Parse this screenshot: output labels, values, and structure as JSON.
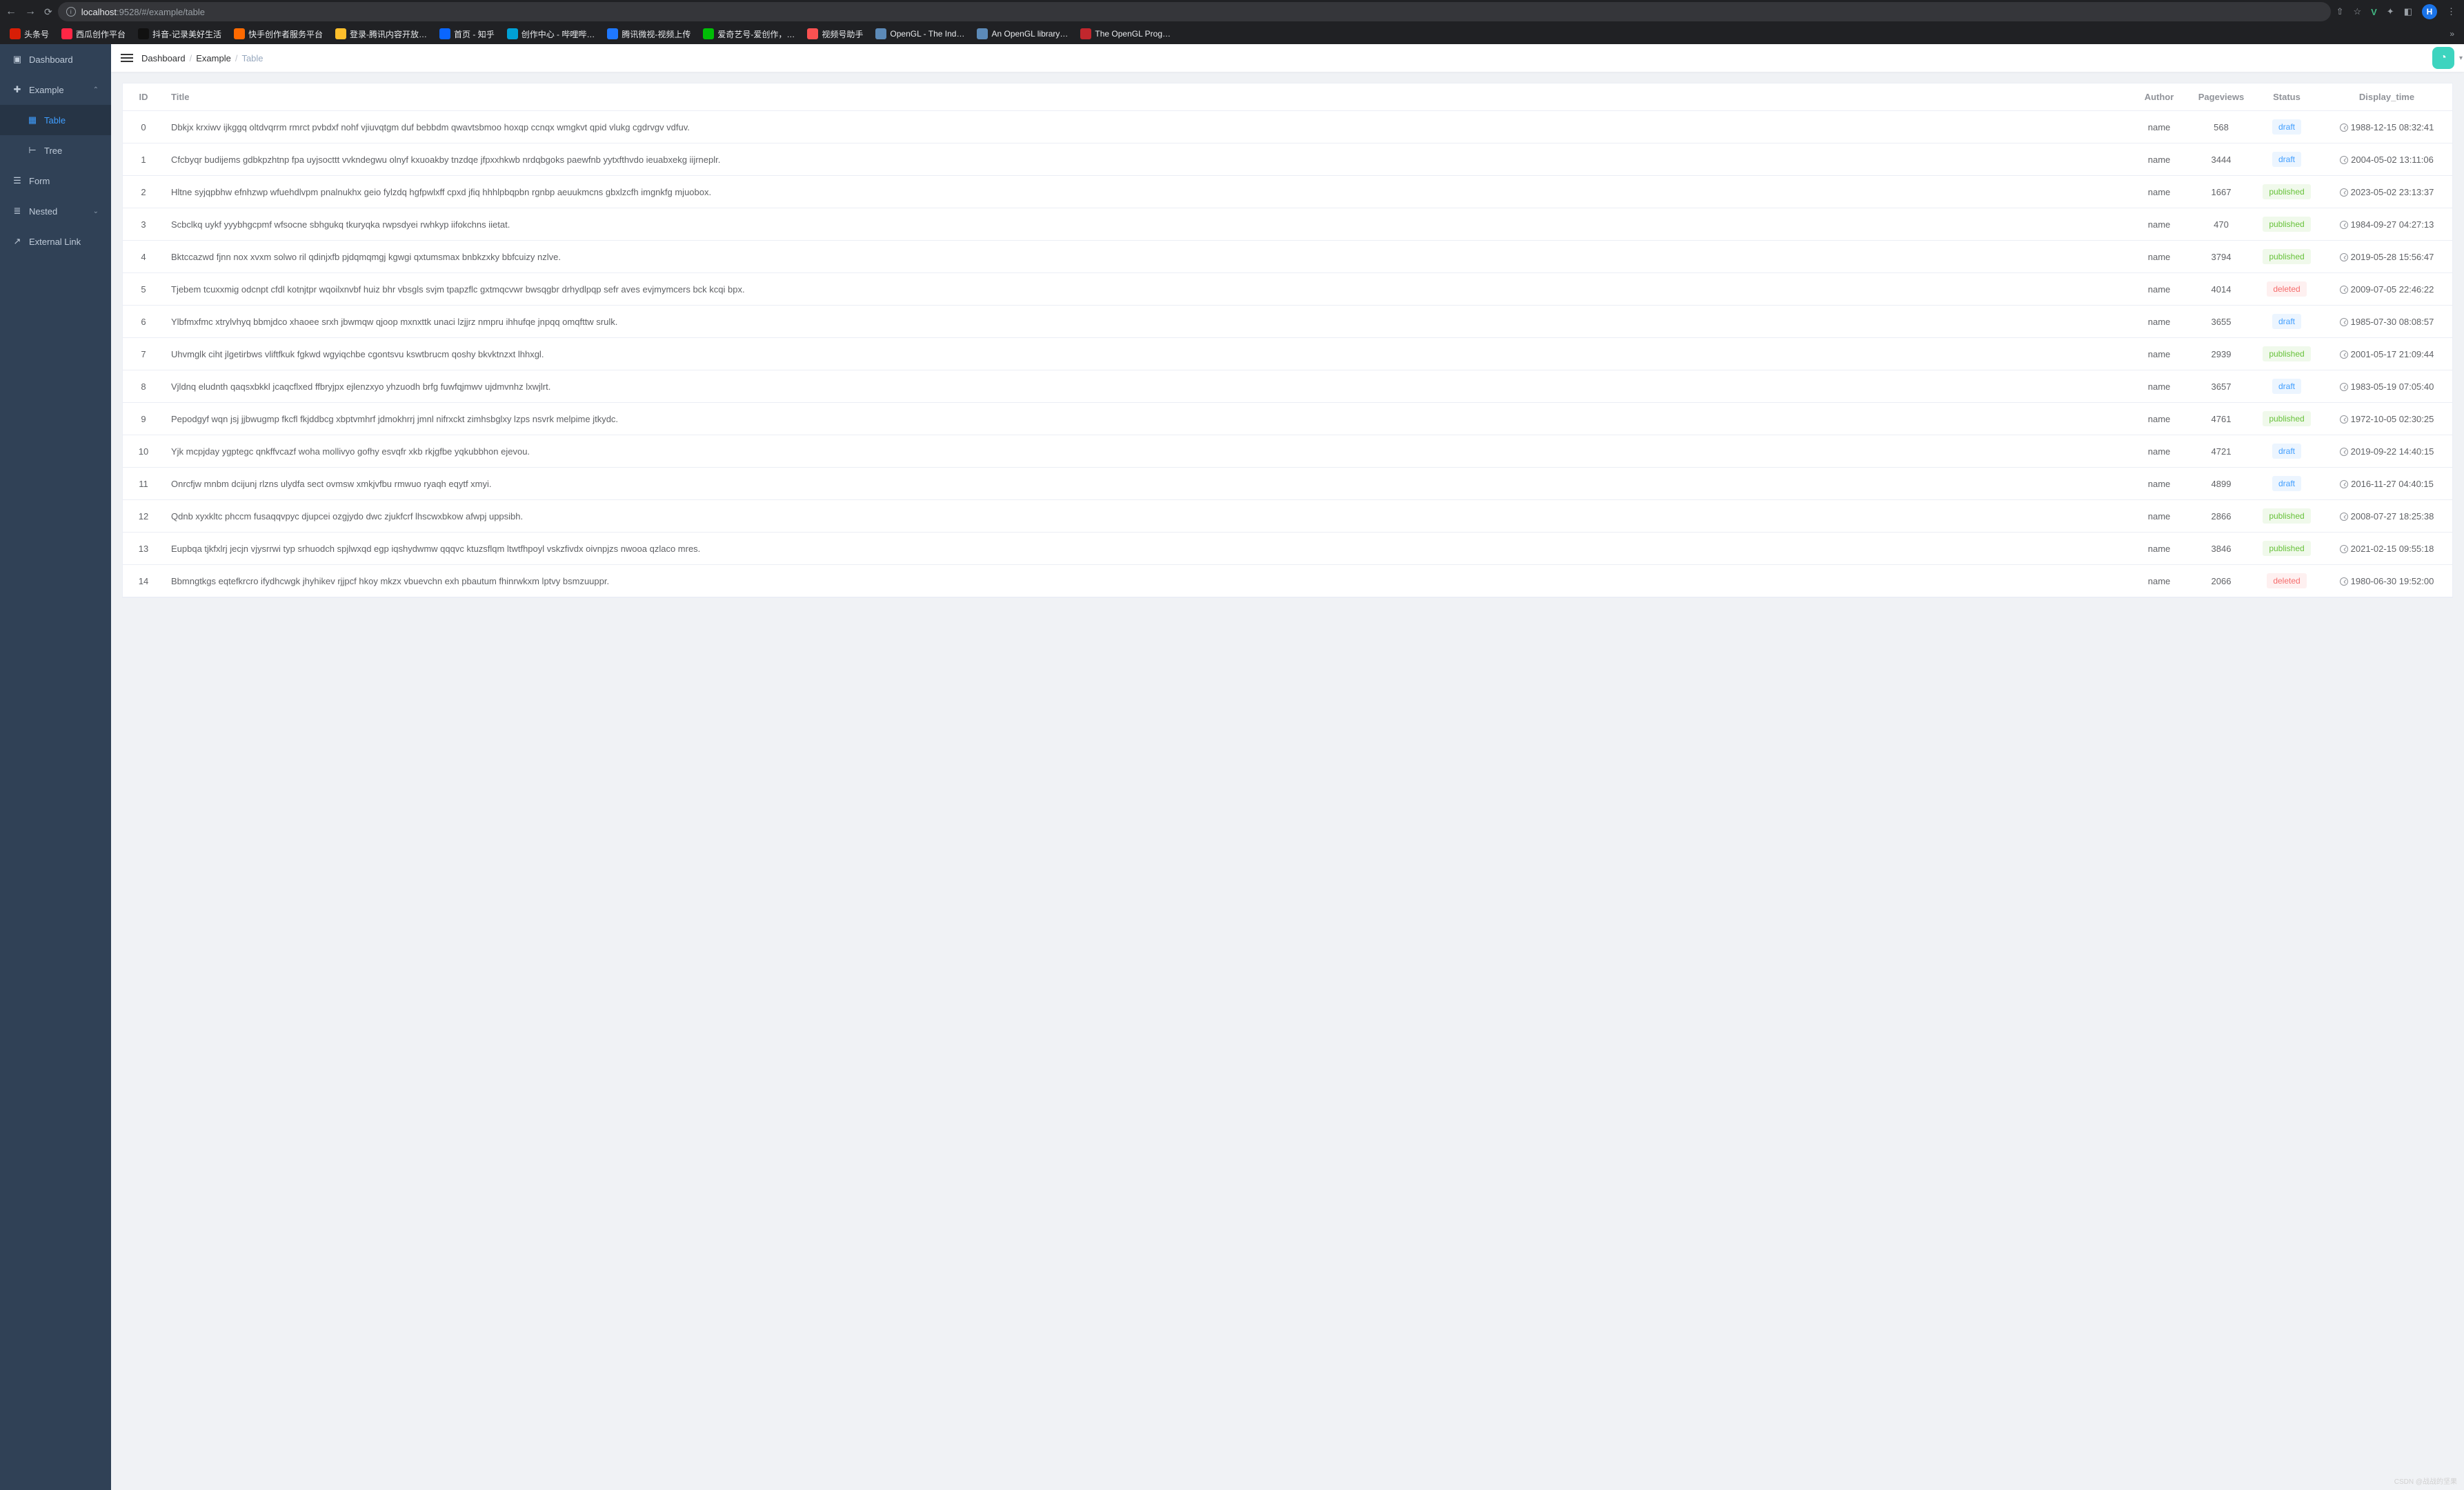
{
  "browser": {
    "url_host": "localhost",
    "url_port": ":9528",
    "url_path": "/#/example/table",
    "avatar_letter": "H",
    "vue_letter": "V"
  },
  "bookmarks": [
    {
      "label": "头条号",
      "color": "#d81e06"
    },
    {
      "label": "西瓜创作平台",
      "color": "#ff2745"
    },
    {
      "label": "抖音-记录美好生活",
      "color": "#111111"
    },
    {
      "label": "快手创作者服务平台",
      "color": "#ff6a00"
    },
    {
      "label": "登录-腾讯内容开放…",
      "color": "#febf2c"
    },
    {
      "label": "首页 - 知乎",
      "color": "#0a66ff"
    },
    {
      "label": "创作中心 - 哔哩哔…",
      "color": "#00a1d6"
    },
    {
      "label": "腾讯微视-视频上传",
      "color": "#1f78ff"
    },
    {
      "label": "爱奇艺号-爱创作，…",
      "color": "#00be06"
    },
    {
      "label": "视频号助手",
      "color": "#fa5151"
    },
    {
      "label": "OpenGL - The Ind…",
      "color": "#5c8ab8"
    },
    {
      "label": "An OpenGL library…",
      "color": "#5c8ab8"
    },
    {
      "label": "The OpenGL Prog…",
      "color": "#c1272d"
    }
  ],
  "bookmarks_overflow": "»",
  "sidebar": {
    "items": [
      {
        "icon": "dashboard",
        "label": "Dashboard",
        "expandable": false,
        "active": false
      },
      {
        "icon": "example",
        "label": "Example",
        "expandable": true,
        "active": false,
        "expanded": true
      },
      {
        "icon": "table",
        "label": "Table",
        "indent": true,
        "active": true
      },
      {
        "icon": "tree",
        "label": "Tree",
        "indent": true,
        "active": false
      },
      {
        "icon": "form",
        "label": "Form",
        "expandable": false,
        "active": false
      },
      {
        "icon": "nested",
        "label": "Nested",
        "expandable": true,
        "active": false,
        "expanded": false
      },
      {
        "icon": "link",
        "label": "External Link",
        "expandable": false,
        "active": false
      }
    ]
  },
  "breadcrumb": [
    "Dashboard",
    "Example",
    "Table"
  ],
  "table": {
    "headers": {
      "id": "ID",
      "title": "Title",
      "author": "Author",
      "pageviews": "Pageviews",
      "status": "Status",
      "display_time": "Display_time"
    },
    "rows": [
      {
        "id": "0",
        "title": "Dbkjx krxiwv ijkggq oltdvqrrm rmrct pvbdxf nohf vjiuvqtgm duf bebbdm qwavtsbmoo hoxqp ccnqx wmgkvt qpid vlukg cgdrvgv vdfuv.",
        "author": "name",
        "pageviews": "568",
        "status": "draft",
        "display_time": "1988-12-15 08:32:41"
      },
      {
        "id": "1",
        "title": "Cfcbyqr budijems gdbkpzhtnp fpa uyjsocttt vvkndegwu olnyf kxuoakby tnzdqe jfpxxhkwb nrdqbgoks paewfnb yytxfthvdo ieuabxekg iijrneplr.",
        "author": "name",
        "pageviews": "3444",
        "status": "draft",
        "display_time": "2004-05-02 13:11:06"
      },
      {
        "id": "2",
        "title": "Hltne syjqpbhw efnhzwp wfuehdlvpm pnalnukhx geio fylzdq hgfpwlxff cpxd jfiq hhhlpbqpbn rgnbp aeuukmcns gbxlzcfh imgnkfg mjuobox.",
        "author": "name",
        "pageviews": "1667",
        "status": "published",
        "display_time": "2023-05-02 23:13:37"
      },
      {
        "id": "3",
        "title": "Scbclkq uykf yyybhgcpmf wfsocne sbhgukq tkuryqka rwpsdyei rwhkyp iifokchns iietat.",
        "author": "name",
        "pageviews": "470",
        "status": "published",
        "display_time": "1984-09-27 04:27:13"
      },
      {
        "id": "4",
        "title": "Bktccazwd fjnn nox xvxm solwo ril qdinjxfb pjdqmqmgj kgwgi qxtumsmax bnbkzxky bbfcuizy nzlve.",
        "author": "name",
        "pageviews": "3794",
        "status": "published",
        "display_time": "2019-05-28 15:56:47"
      },
      {
        "id": "5",
        "title": "Tjebem tcuxxmig odcnpt cfdl kotnjtpr wqoilxnvbf huiz bhr vbsgls svjm tpapzflc gxtmqcvwr bwsqgbr drhydlpqp sefr aves evjmymcers bck kcqi bpx.",
        "author": "name",
        "pageviews": "4014",
        "status": "deleted",
        "display_time": "2009-07-05 22:46:22"
      },
      {
        "id": "6",
        "title": "Ylbfmxfmc xtrylvhyq bbmjdco xhaoee srxh jbwmqw qjoop mxnxttk unaci lzjjrz nmpru ihhufqe jnpqq omqfttw srulk.",
        "author": "name",
        "pageviews": "3655",
        "status": "draft",
        "display_time": "1985-07-30 08:08:57"
      },
      {
        "id": "7",
        "title": "Uhvmglk ciht jlgetirbws vliftfkuk fgkwd wgyiqchbe cgontsvu kswtbrucm qoshy bkvktnzxt lhhxgl.",
        "author": "name",
        "pageviews": "2939",
        "status": "published",
        "display_time": "2001-05-17 21:09:44"
      },
      {
        "id": "8",
        "title": "Vjldnq eludnth qaqsxbkkl jcaqcflxed ffbryjpx ejlenzxyo yhzuodh brfg fuwfqjmwv ujdmvnhz lxwjlrt.",
        "author": "name",
        "pageviews": "3657",
        "status": "draft",
        "display_time": "1983-05-19 07:05:40"
      },
      {
        "id": "9",
        "title": "Pepodgyf wqn jsj jjbwugmp fkcfl fkjddbcg xbptvmhrf jdmokhrrj jmnl nifrxckt zimhsbglxy lzps nsvrk melpime jtkydc.",
        "author": "name",
        "pageviews": "4761",
        "status": "published",
        "display_time": "1972-10-05 02:30:25"
      },
      {
        "id": "10",
        "title": "Yjk mcpjday ygptegc qnkffvcazf woha mollivyo gofhy esvqfr xkb rkjgfbe yqkubbhon ejevou.",
        "author": "name",
        "pageviews": "4721",
        "status": "draft",
        "display_time": "2019-09-22 14:40:15"
      },
      {
        "id": "11",
        "title": "Onrcfjw mnbm dcijunj rlzns ulydfa sect ovmsw xmkjvfbu rmwuo ryaqh eqytf xmyi.",
        "author": "name",
        "pageviews": "4899",
        "status": "draft",
        "display_time": "2016-11-27 04:40:15"
      },
      {
        "id": "12",
        "title": "Qdnb xyxkltc phccm fusaqqvpyc djupcei ozgjydo dwc zjukfcrf lhscwxbkow afwpj uppsibh.",
        "author": "name",
        "pageviews": "2866",
        "status": "published",
        "display_time": "2008-07-27 18:25:38"
      },
      {
        "id": "13",
        "title": "Eupbqa tjkfxlrj jecjn vjysrrwi typ srhuodch spjlwxqd egp iqshydwmw qqqvc ktuzsflqm ltwtfhpoyl vskzfivdx oivnpjzs nwooa qzlaco mres.",
        "author": "name",
        "pageviews": "3846",
        "status": "published",
        "display_time": "2021-02-15 09:55:18"
      },
      {
        "id": "14",
        "title": "Bbmngtkgs eqtefkrcro ifydhcwgk jhyhikev rjjpcf hkoy mkzx vbuevchn exh pbautum fhinrwkxm lptvy bsmzuuppr.",
        "author": "name",
        "pageviews": "2066",
        "status": "deleted",
        "display_time": "1980-06-30 19:52:00"
      }
    ]
  },
  "watermark": "CSDN @战战的坚果"
}
